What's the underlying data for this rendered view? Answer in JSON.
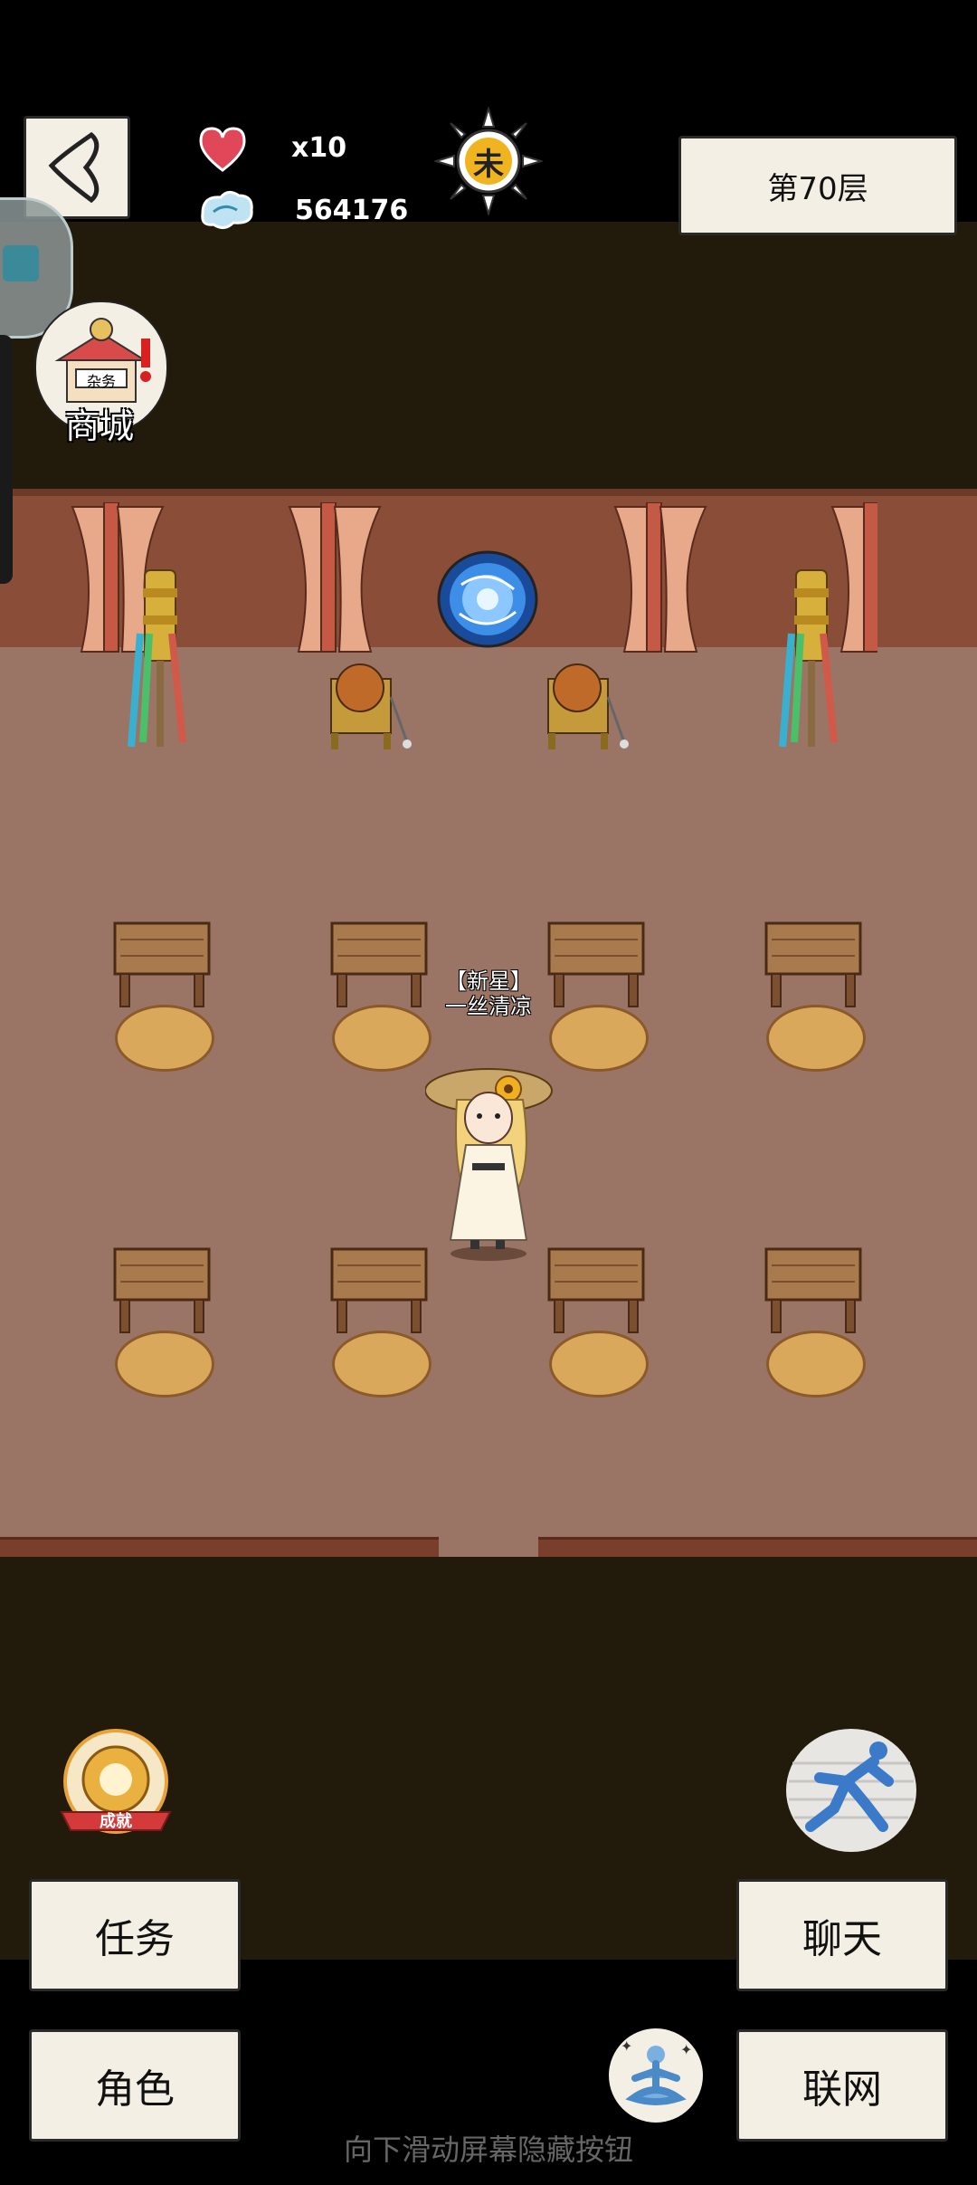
{
  "header": {
    "lives": "x10",
    "currency": "564176",
    "time_symbol": "未",
    "floor_label": "第70层"
  },
  "shop": {
    "sign_text": "杂务",
    "label": "商城"
  },
  "character": {
    "title": "【新星】",
    "name": "一丝清凉"
  },
  "achievement": {
    "label": "成就"
  },
  "buttons": {
    "tasks": "任务",
    "chat": "聊天",
    "character": "角色",
    "network": "联网"
  },
  "hint": "向下滑动屏幕隐藏按钮",
  "colors": {
    "button_bg": "#f4efe4",
    "floor": "#9a7566",
    "wall": "#8a4e38",
    "dark": "#221a0b"
  }
}
